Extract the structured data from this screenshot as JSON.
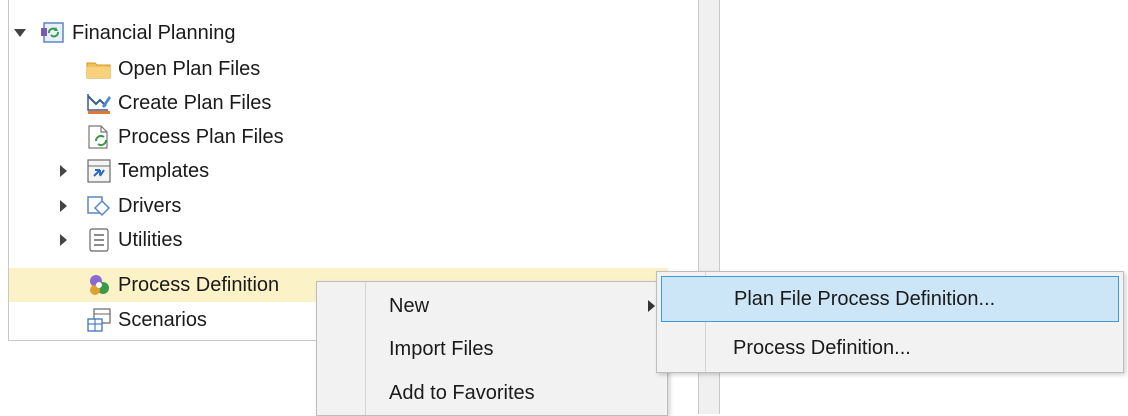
{
  "tree": {
    "root": {
      "label": "Financial Planning",
      "expanded": true
    },
    "items": [
      {
        "label": "Open Plan Files",
        "icon": "folder-icon"
      },
      {
        "label": "Create Plan Files",
        "icon": "create-plan-icon"
      },
      {
        "label": "Process Plan Files",
        "icon": "process-plan-icon"
      },
      {
        "label": "Templates",
        "icon": "templates-icon",
        "expandable": true
      },
      {
        "label": "Drivers",
        "icon": "drivers-icon",
        "expandable": true
      },
      {
        "label": "Utilities",
        "icon": "utilities-icon",
        "expandable": true
      },
      {
        "label": "Process Definition",
        "icon": "process-definition-icon",
        "selected": true
      },
      {
        "label": "Scenarios",
        "icon": "scenarios-icon"
      }
    ]
  },
  "context_menu": {
    "items": [
      {
        "label": "New",
        "has_submenu": true
      },
      {
        "label": "Import Files"
      },
      {
        "label": "Add to Favorites"
      }
    ]
  },
  "submenu": {
    "items": [
      {
        "label": "Plan File Process Definition...",
        "highlighted": true
      },
      {
        "label": "Process Definition..."
      }
    ]
  },
  "colors": {
    "selected_row": "#fcf2c8",
    "hover_item": "#cde6f7",
    "hover_border": "#3f9bd8",
    "menu_bg": "#f2f2f2"
  }
}
